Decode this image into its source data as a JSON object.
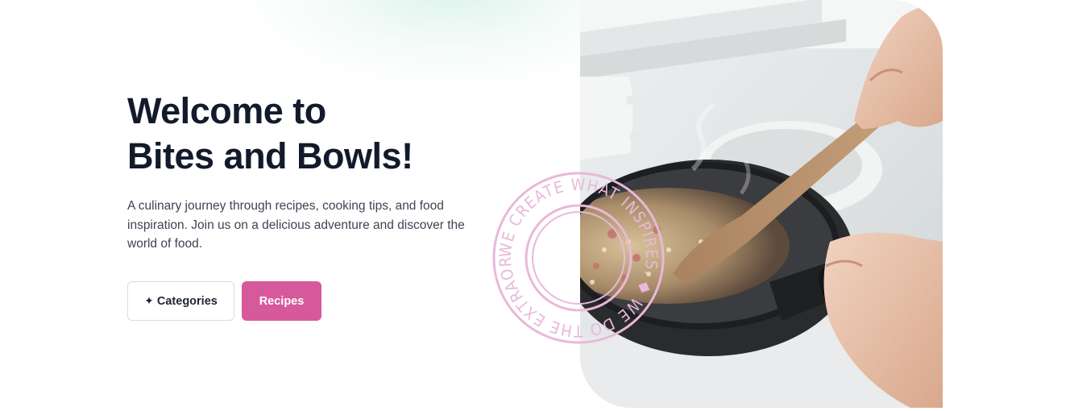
{
  "hero": {
    "title_line1": "Welcome to",
    "title_line2": "Bites and Bowls!",
    "description": "A culinary journey through recipes, cooking tips, and food inspiration. Join us on a delicious adventure and discover the world of food."
  },
  "buttons": {
    "categories_icon": "✦",
    "categories_label": "Categories",
    "recipes_label": "Recipes"
  },
  "stamp": {
    "text": "WE CREATE WHAT INSPIRES. ◆ WE DO THE EXTRAORDINARY. ◆"
  },
  "colors": {
    "accent": "#d65a9b",
    "heading": "#131a2b",
    "stamp": "#eab8d8"
  },
  "icons": {
    "categories": "sparkle-icon"
  }
}
